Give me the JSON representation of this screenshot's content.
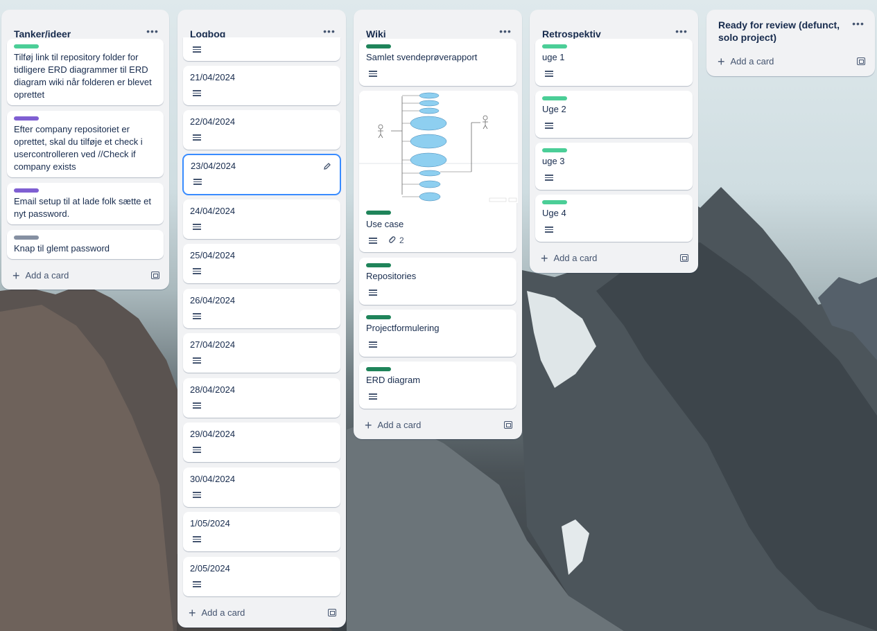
{
  "colors": {
    "label_green": "#4bce97",
    "label_purple": "#7f5fd2",
    "label_gray": "#8590a2",
    "label_darkgreen": "#1f845a"
  },
  "lists": {
    "tanker": {
      "title": "Tanker/ideer",
      "cards": [
        {
          "title": "Tilføj link til repository folder for tidligere ERD diagrammer til ERD diagram wiki når folderen er blevet oprettet",
          "label": "green"
        },
        {
          "title": "Efter company repositoriet er oprettet, skal du tilføje et check i usercontrolleren ved //Check if company exists",
          "label": "purple"
        },
        {
          "title": "Email setup til at lade folk sætte et nyt password.",
          "label": "purple"
        },
        {
          "title": "Knap til glemt password",
          "label": "gray"
        }
      ],
      "add_card": "Add a card"
    },
    "logbog": {
      "title": "Logbog",
      "cards": [
        "21/04/2024",
        "22/04/2024",
        "23/04/2024",
        "24/04/2024",
        "25/04/2024",
        "26/04/2024",
        "27/04/2024",
        "28/04/2024",
        "29/04/2024",
        "30/04/2024",
        "1/05/2024",
        "2/05/2024"
      ],
      "add_card": "Add a card"
    },
    "wiki": {
      "title": "Wiki",
      "cards": [
        "Samlet svendeprøverapport",
        "Use case",
        "Repositories",
        "Projectformulering",
        "ERD diagram"
      ],
      "attachment_count": "2",
      "add_card": "Add a card"
    },
    "retro": {
      "title": "Retrospektiv",
      "cards": [
        "uge 1",
        "Uge 2",
        "uge 3",
        "Uge 4"
      ],
      "add_card": "Add a card"
    },
    "review": {
      "title": "Ready for review (defunct, solo project)",
      "add_card": "Add a card"
    }
  },
  "icons": {
    "list_menu": "more-horizontal-icon",
    "description": "description-icon",
    "attachment": "paperclip-icon",
    "add": "plus-icon",
    "template": "card-template-icon",
    "edit": "pencil-icon"
  }
}
